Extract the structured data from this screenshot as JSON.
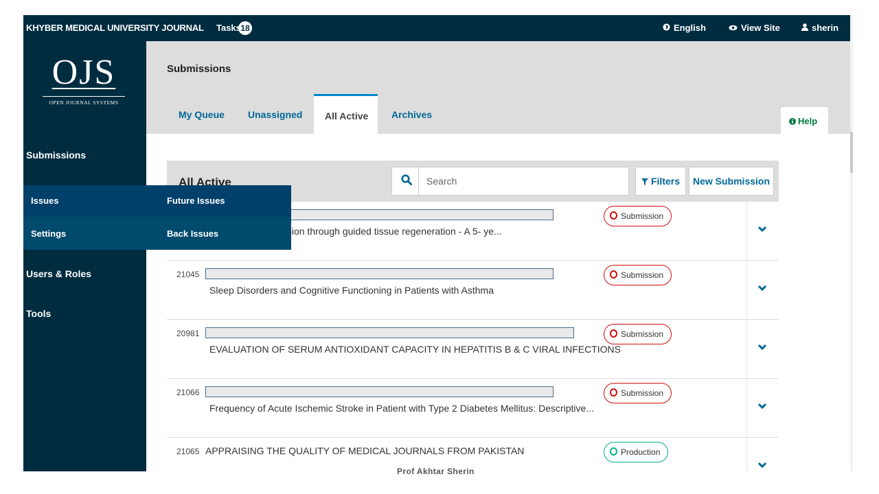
{
  "topbar": {
    "brand": "KHYBER MEDICAL UNIVERSITY JOURNAL",
    "tasks_label": "Tasks",
    "tasks_count": "18",
    "language": "English",
    "view_site": "View Site",
    "user": "sherin"
  },
  "logo": {
    "title": "OJS",
    "subtitle": "OPEN JOURNAL SYSTEMS"
  },
  "sidebar": {
    "items": [
      "Submissions",
      "Issues",
      "Settings",
      "Users & Roles",
      "Tools"
    ]
  },
  "issues_menu": {
    "items": [
      "Future Issues",
      "Back Issues"
    ]
  },
  "header": {
    "title": "Submissions",
    "tabs": [
      "My Queue",
      "Unassigned",
      "All Active",
      "Archives"
    ],
    "active_tab": "All Active",
    "help": "Help"
  },
  "list": {
    "title": "All Active",
    "search_placeholder": "Search",
    "filters": "Filters",
    "new_submission": "New Submission",
    "rows": [
      {
        "id": "",
        "title": "nt of endo-perio lesion through guided tissue regeneration - A 5- ye...",
        "stage": "Submission"
      },
      {
        "id": "21045",
        "title": "Sleep Disorders and Cognitive Functioning in Patients with Asthma",
        "stage": "Submission"
      },
      {
        "id": "20981",
        "title": "EVALUATION OF SERUM ANTIOXIDANT CAPACITY IN HEPATITIS B & C VIRAL INFECTIONS",
        "stage": "Submission"
      },
      {
        "id": "21066",
        "title": "Frequency of Acute Ischemic Stroke in Patient with Type 2 Diabetes Mellitus: Descriptive...",
        "stage": "Submission"
      },
      {
        "id": "21065",
        "title": "APPRAISING THE QUALITY OF MEDICAL JOURNALS FROM PAKISTAN",
        "stage": "Production"
      }
    ]
  },
  "footer_note": "Prof Akhtar Sherin",
  "colors": {
    "navy": "#002c40",
    "link": "#006798",
    "submission": "#d00a0a",
    "production": "#00b28d",
    "help": "#007a3d"
  }
}
